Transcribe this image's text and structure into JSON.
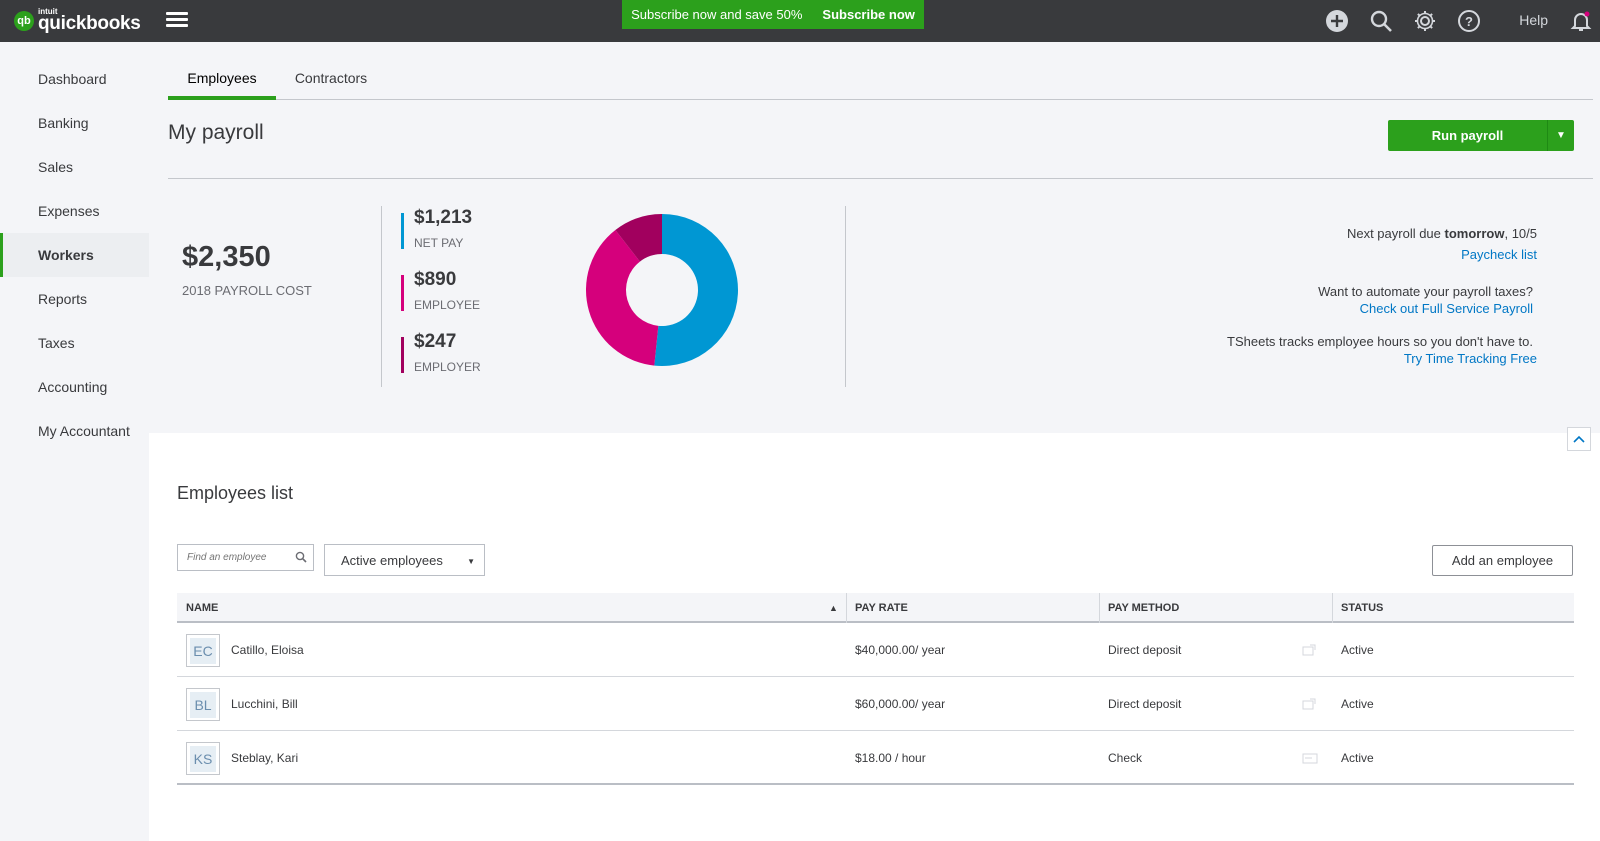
{
  "brand": {
    "intuit": "intuit",
    "name": "quickbooks",
    "mark": "qb",
    "accent": "#2ca01c"
  },
  "promo": {
    "text": "Subscribe now and save 50%",
    "cta": "Subscribe now"
  },
  "topbar": {
    "help_label": "Help",
    "icons": [
      "plus-icon",
      "search-icon",
      "gear-icon",
      "help-icon",
      "bell-icon"
    ]
  },
  "sidebar": {
    "items": [
      {
        "label": "Dashboard",
        "active": false
      },
      {
        "label": "Banking",
        "active": false
      },
      {
        "label": "Sales",
        "active": false
      },
      {
        "label": "Expenses",
        "active": false
      },
      {
        "label": "Workers",
        "active": true
      },
      {
        "label": "Reports",
        "active": false
      },
      {
        "label": "Taxes",
        "active": false
      },
      {
        "label": "Accounting",
        "active": false
      },
      {
        "label": "My Accountant",
        "active": false
      }
    ]
  },
  "tabs": [
    {
      "label": "Employees",
      "active": true
    },
    {
      "label": "Contractors",
      "active": false
    }
  ],
  "page": {
    "title": "My payroll",
    "run_payroll_label": "Run payroll"
  },
  "summary": {
    "total": {
      "amount": "$2,350",
      "label": "2018 PAYROLL COST"
    },
    "breakdown": [
      {
        "amount": "$1,213",
        "label": "NET PAY",
        "color": "#0097d3",
        "value": 1213
      },
      {
        "amount": "$890",
        "label": "EMPLOYEE",
        "color": "#d5007c",
        "value": 890
      },
      {
        "amount": "$247",
        "label": "EMPLOYER",
        "color": "#a1005e",
        "value": 247
      }
    ],
    "next_payroll": {
      "prefix": "Next payroll due ",
      "when": "tomorrow",
      "date": ", 10/5"
    },
    "paycheck_link": "Paycheck list",
    "automate_text": "Want to automate your payroll taxes?",
    "automate_link": "Check out Full Service Payroll",
    "tsheets_text": "TSheets tracks employee hours so you don't have to.",
    "tsheets_link": "Try Time Tracking Free"
  },
  "employees_list": {
    "title": "Employees list",
    "search_placeholder": "Find an employee",
    "filter_value": "Active employees",
    "add_button": "Add an employee",
    "columns": [
      "NAME",
      "PAY RATE",
      "PAY METHOD",
      "STATUS"
    ],
    "rows": [
      {
        "initials": "EC",
        "name": "Catillo, Eloisa",
        "pay_rate": "$40,000.00/ year",
        "pay_method": "Direct deposit",
        "method_icon": "paystub-icon",
        "status": "Active"
      },
      {
        "initials": "BL",
        "name": "Lucchini, Bill",
        "pay_rate": "$60,000.00/ year",
        "pay_method": "Direct deposit",
        "method_icon": "paystub-icon",
        "status": "Active"
      },
      {
        "initials": "KS",
        "name": "Steblay, Kari",
        "pay_rate": "$18.00 / hour",
        "pay_method": "Check",
        "method_icon": "check-icon",
        "status": "Active"
      }
    ]
  }
}
